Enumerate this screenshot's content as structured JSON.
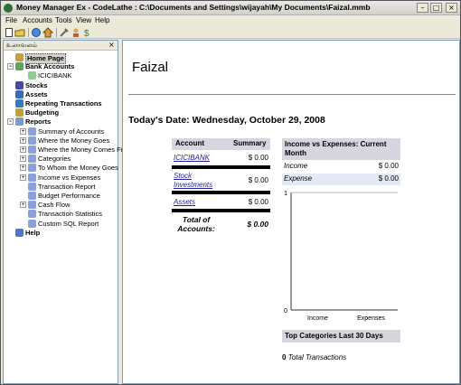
{
  "window": {
    "title": "Money Manager Ex - CodeLathe : C:\\Documents and Settings\\wijayah\\My Documents\\Faizal.mmb"
  },
  "menu": [
    {
      "label": "File"
    },
    {
      "label": "Accounts"
    },
    {
      "label": "Tools"
    },
    {
      "label": "View"
    },
    {
      "label": "Help"
    }
  ],
  "toolbar": {
    "icons": [
      "new-icon",
      "open-icon",
      "new-account-icon",
      "home-icon",
      "settings-icon",
      "organize-payees-icon",
      "currency-icon"
    ]
  },
  "nav": {
    "header_label": "உலாவலம்",
    "close_glyph": "×",
    "items": [
      {
        "label": "Home Page",
        "bold": true,
        "selected": true
      },
      {
        "label": "Bank Accounts",
        "bold": true,
        "expander": "-"
      },
      {
        "label": "ICICIBANK",
        "bold": false
      },
      {
        "label": "Stocks",
        "bold": true
      },
      {
        "label": "Assets",
        "bold": true
      },
      {
        "label": "Repeating Transactions",
        "bold": true
      },
      {
        "label": "Budgeting",
        "bold": true
      },
      {
        "label": "Reports",
        "bold": true,
        "expander": "-"
      },
      {
        "label": "Summary of Accounts",
        "bold": false,
        "expander": "+"
      },
      {
        "label": "Where the Money Goes",
        "bold": false,
        "expander": "+"
      },
      {
        "label": "Where the Money Comes Fr",
        "bold": false,
        "expander": "+"
      },
      {
        "label": "Categories",
        "bold": false,
        "expander": "+"
      },
      {
        "label": "To Whom the Money Goes",
        "bold": false,
        "expander": "+"
      },
      {
        "label": "Income vs Expenses",
        "bold": false,
        "expander": "+"
      },
      {
        "label": "Transaction Report",
        "bold": false
      },
      {
        "label": "Budget Performance",
        "bold": false
      },
      {
        "label": "Cash Flow",
        "bold": false,
        "expander": "+"
      },
      {
        "label": "Transaction Statistics",
        "bold": false
      },
      {
        "label": "Custom SQL Report",
        "bold": false
      },
      {
        "label": "Help",
        "bold": true
      }
    ]
  },
  "home": {
    "user_name": "Faizal",
    "today_label": "Today's Date: Wednesday, October 29, 2008",
    "accounts_table": {
      "col_account": "Account",
      "col_summary": "Summary",
      "rows": [
        {
          "account": "ICICIBANK",
          "summary": "$ 0.00"
        },
        {
          "account": "Stock Investments",
          "summary": "$ 0.00"
        },
        {
          "account": "Assets",
          "summary": "$ 0.00"
        }
      ],
      "total_label": "Total of Accounts:",
      "total_value": "$ 0.00"
    },
    "income_expenses": {
      "title": "Income vs Expenses: Current Month",
      "rows": [
        {
          "label": "Income",
          "value": "$ 0.00"
        },
        {
          "label": "Expense",
          "value": "$ 0.00"
        }
      ]
    },
    "top_categories_title": "Top Categories Last 30 Days",
    "total_transactions_count": "0",
    "total_transactions_label": "Total Transactions"
  },
  "chart_data": {
    "type": "bar",
    "categories": [
      "Income",
      "Expenses"
    ],
    "values": [
      0,
      0
    ],
    "ylim": [
      0,
      1
    ],
    "yticks": [
      "0",
      "1"
    ],
    "grid": false
  }
}
